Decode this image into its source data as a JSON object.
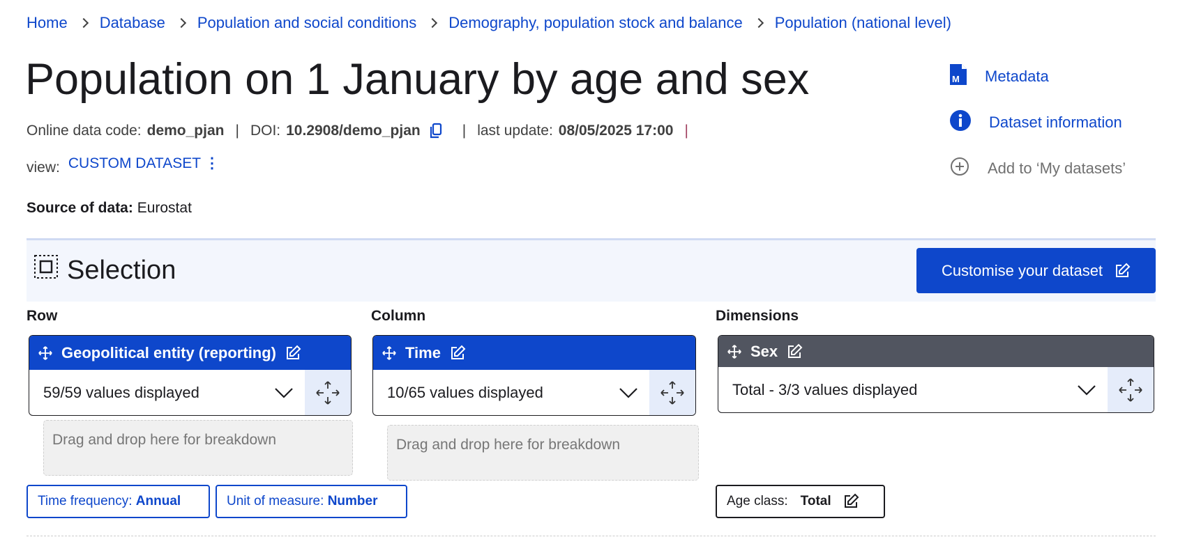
{
  "breadcrumb": [
    "Home",
    "Database",
    "Population and social conditions",
    "Demography, population stock and balance",
    "Population (national level)"
  ],
  "title": "Population on 1 January by age and sex",
  "meta": {
    "code_label": "Online data code:",
    "code": "demo_pjan",
    "doi_label": "DOI:",
    "doi": "10.2908/demo_pjan",
    "update_label": "last update:",
    "update": "08/05/2025 17:00",
    "sep": "|"
  },
  "view": {
    "label": "view:",
    "value": "CUSTOM DATASET"
  },
  "source": {
    "label": "Source of data:",
    "value": "Eurostat"
  },
  "side_links": {
    "metadata": "Metadata",
    "info": "Dataset information",
    "add": "Add to ‘My datasets’"
  },
  "selection": {
    "title": "Selection",
    "customise": "Customise your dataset"
  },
  "row": {
    "label": "Row",
    "dimension": "Geopolitical entity (reporting)",
    "values": "59/59 values displayed",
    "drop": "Drag and drop here for breakdown"
  },
  "column": {
    "label": "Column",
    "dimension": "Time",
    "values": "10/65 values displayed",
    "drop": "Drag and drop here for breakdown"
  },
  "dimensions": {
    "label": "Dimensions",
    "dimension": "Sex",
    "values": "Total - 3/3 values displayed"
  },
  "chips": {
    "freq_label": "Time frequency:",
    "freq": "Annual",
    "unit_label": "Unit of measure:",
    "unit": "Number",
    "age_label": "Age class:",
    "age": "Total"
  },
  "colors": {
    "brand": "#0e47cb",
    "dark_header": "#515560"
  }
}
